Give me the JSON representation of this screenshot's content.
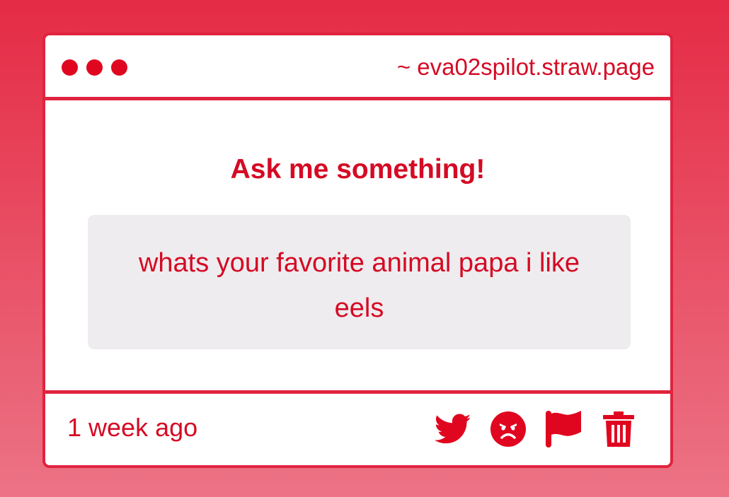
{
  "window": {
    "url": "~ eva02spilot.straw.page"
  },
  "main": {
    "heading": "Ask me something!",
    "question": "whats your favorite animal papa i like eels"
  },
  "footer": {
    "timestamp": "1 week ago",
    "actions": [
      {
        "icon": "twitter-icon"
      },
      {
        "icon": "angry-face-icon"
      },
      {
        "icon": "flag-icon"
      },
      {
        "icon": "trash-icon"
      }
    ]
  },
  "colors": {
    "accent": "#e0061f",
    "text": "#d50a24",
    "background_top": "#e52b45",
    "background_bottom": "#ec7385",
    "question_bg": "#eeecee"
  }
}
